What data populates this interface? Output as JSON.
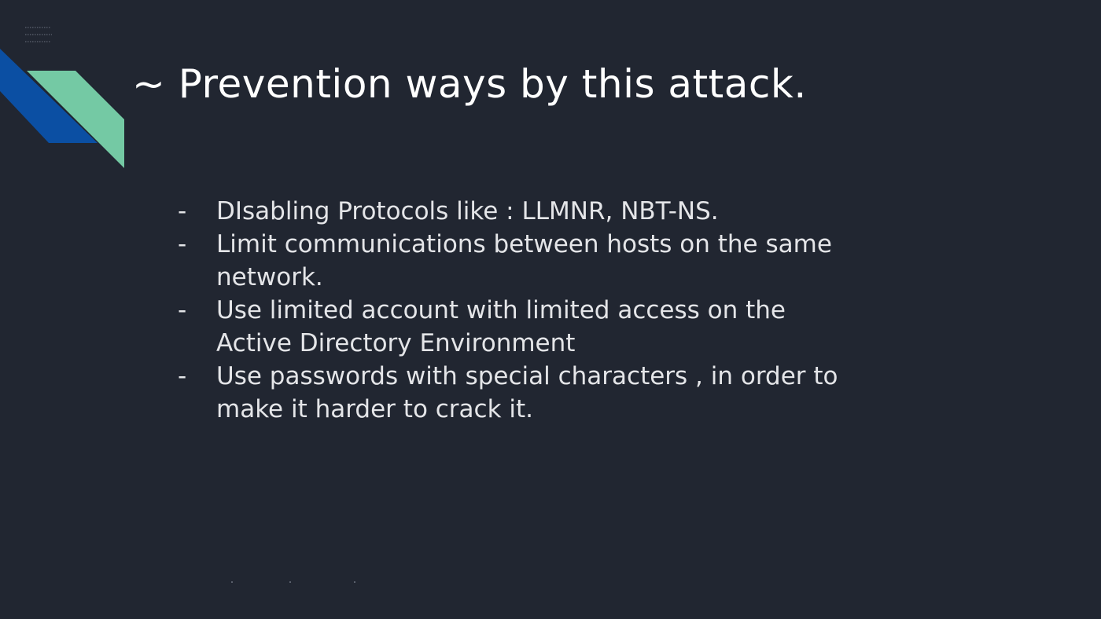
{
  "slide": {
    "background_color": "#212631",
    "accent_colors": {
      "blue": "#0b4fa3",
      "teal": "#74c9a4"
    },
    "title": "~ Prevention ways by this attack.",
    "bullet_marker": "-",
    "bullets": [
      {
        "text": "DIsabling Protocols like : LLMNR, NBT-NS."
      },
      {
        "text": "Limit communications between hosts on the same network."
      },
      {
        "text": "Use limited account with limited access on the Active Directory Environment"
      },
      {
        "text": "Use passwords with special characters , in order to make it harder to crack it."
      }
    ]
  }
}
